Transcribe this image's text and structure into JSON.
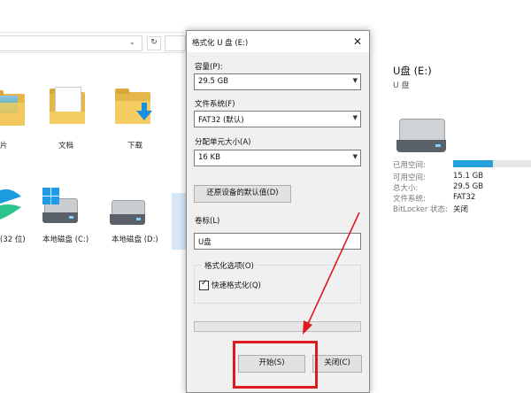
{
  "explorer": {
    "folders": [
      {
        "label": "片"
      },
      {
        "label": "文档"
      },
      {
        "label": "下载"
      }
    ],
    "drives": [
      {
        "label": "(32 位)"
      },
      {
        "label": "本地磁盘 (C:)"
      },
      {
        "label": "本地磁盘 (D:)"
      }
    ],
    "address": {
      "refresh_glyph": "↻",
      "dropdown_glyph": "⌄"
    },
    "details": {
      "title": "U盘 (E:)",
      "subtitle": "U 盘",
      "usage_fraction": 0.51,
      "rows": [
        {
          "key": "已用空间:",
          "value": ""
        },
        {
          "key": "可用空间:",
          "value": "15.1 GB"
        },
        {
          "key": "总大小:",
          "value": "29.5 GB"
        },
        {
          "key": "文件系统:",
          "value": "FAT32"
        },
        {
          "key": "BitLocker 状态:",
          "value": "关闭"
        }
      ]
    }
  },
  "dialog": {
    "title": "格式化 U 盘 (E:)",
    "close_glyph": "✕",
    "capacity": {
      "label": "容量(P):",
      "value": "29.5 GB"
    },
    "filesystem": {
      "label": "文件系统(F)",
      "value": "FAT32 (默认)"
    },
    "unit": {
      "label": "分配单元大小(A)",
      "value": "16 KB"
    },
    "restore_button": "还原设备的默认值(D)",
    "volume": {
      "label": "卷标(L)",
      "value": "U盘"
    },
    "options": {
      "group_label": "格式化选项(O)",
      "quick_format_label": "快速格式化(Q)",
      "quick_format_checked": true
    },
    "start_button": "开始(S)",
    "close_button": "关闭(C)"
  },
  "colors": {
    "annotation": "#e0191f",
    "accent": "#26a0da"
  }
}
